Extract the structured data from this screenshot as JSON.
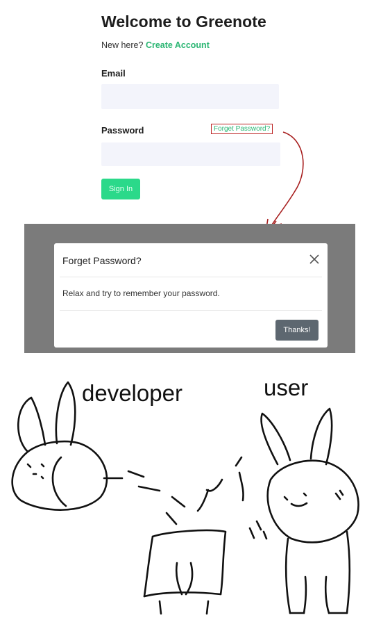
{
  "login": {
    "title": "Welcome to Greenote",
    "new_here": "New here?",
    "create_account": "Create Account",
    "email_label": "Email",
    "password_label": "Password",
    "forgot_link": "Forget Password?",
    "sign_in": "Sign In"
  },
  "modal": {
    "title": "Forget Password?",
    "body": "Relax and try to remember your password.",
    "close_icon": "close-icon",
    "button": "Thanks!"
  },
  "comic": {
    "label_developer": "developer",
    "label_user": "user"
  },
  "colors": {
    "accent_green": "#2bb673",
    "button_green": "#2bd98a",
    "overlay_gray": "#7b7b7b",
    "button_gray": "#5d6770",
    "arrow_red": "#b22222"
  }
}
